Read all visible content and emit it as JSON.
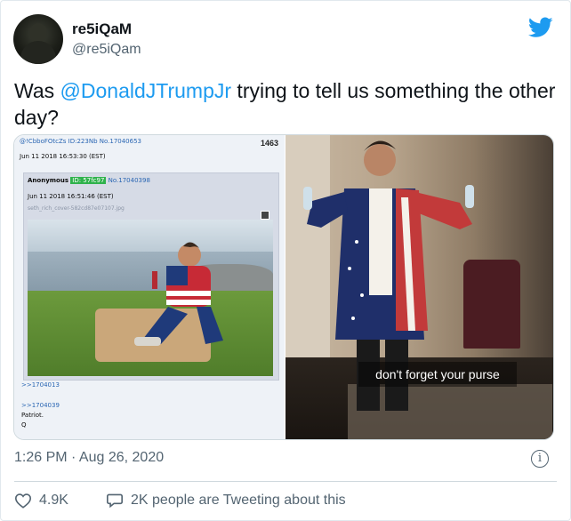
{
  "tweet": {
    "display_name": "re5iQaM",
    "handle": "@re5iQam",
    "text_prefix": "Was ",
    "mention": "@DonaldJTrumpJr",
    "text_suffix": " trying to tell us something the other day?",
    "timestamp": "1:26 PM · Aug 26, 2020",
    "likes": "4.9K",
    "conversation": "2K people are Tweeting about this"
  },
  "media": {
    "left_image": {
      "header_ids": "@!CbboFOtcZs ID:223Nb No.17040653",
      "header_date": "Jun 11 2018 16:53:30 (EST)",
      "post_number": "1463",
      "inner_author": "Anonymous",
      "inner_id": "ID: 57fc97",
      "inner_no": "No.17040398",
      "inner_date": "Jun 11 2018 16:51:46 (EST)",
      "inner_filename": "seth_rich_cover-582cd87e07107.jpg",
      "reply_ref_1": ">>1704013",
      "reply_ref_2": ">>1704039",
      "reply_line_2": "Patriot.",
      "reply_line_3": "Q"
    },
    "right_image": {
      "caption": "don't forget your purse"
    }
  },
  "icons": {
    "brand": "twitter-bird-icon",
    "info": "info-icon",
    "like": "heart-icon",
    "conversation": "speech-bubble-icon"
  },
  "colors": {
    "link": "#1d9bf0",
    "muted": "#536471",
    "brand": "#1d9bf0"
  }
}
